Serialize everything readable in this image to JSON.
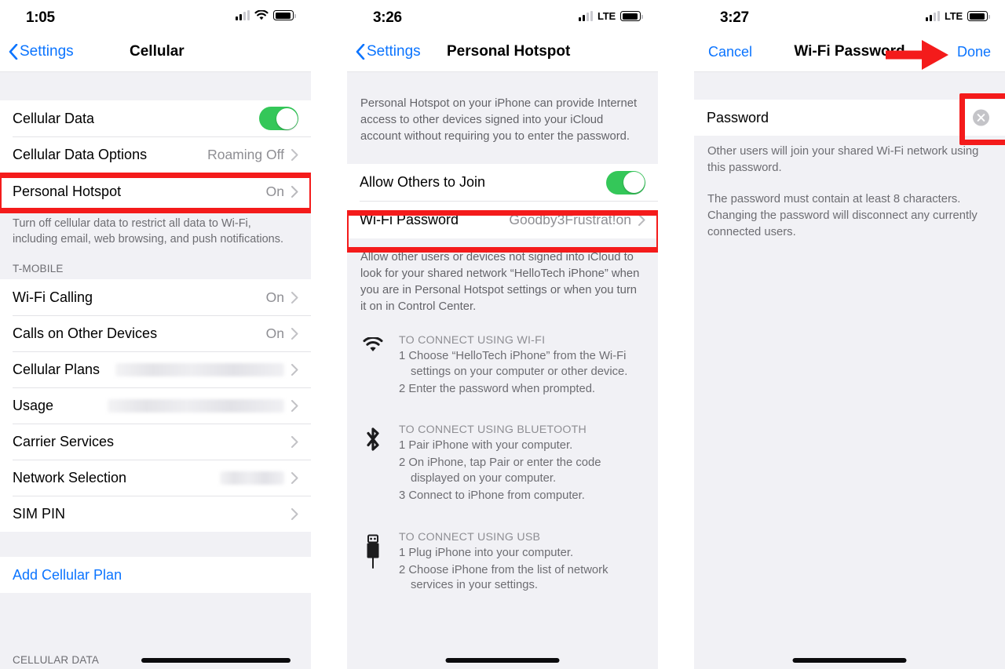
{
  "panels": [
    {
      "status": {
        "time": "1:05",
        "connectivity": "wifi",
        "signal_icon": "signal-bars-icon",
        "wifi_icon": "wifi-icon",
        "battery_icon": "battery-icon"
      },
      "nav": {
        "back_label": "Settings",
        "title": "Cellular",
        "back_icon": "chevron-left-icon"
      },
      "rows_group1": [
        {
          "label": "Cellular Data",
          "value": "",
          "control": "toggle",
          "toggle_on": true
        },
        {
          "label": "Cellular Data Options",
          "value": "Roaming Off",
          "control": "chevron"
        },
        {
          "label": "Personal Hotspot",
          "value": "On",
          "control": "chevron",
          "highlighted": true
        }
      ],
      "footnote": "Turn off cellular data to restrict all data to Wi-Fi, including email, web browsing, and push notifications.",
      "group_header": "T-MOBILE",
      "rows_group2": [
        {
          "label": "Wi-Fi Calling",
          "value": "On",
          "control": "chevron"
        },
        {
          "label": "Calls on Other Devices",
          "value": "On",
          "control": "chevron"
        },
        {
          "label": "Cellular Plans",
          "value": "",
          "control": "chevron",
          "redacted": true,
          "redact_width": 215
        },
        {
          "label": "Usage",
          "value": "",
          "control": "chevron",
          "redacted": true,
          "redact_width": 225
        },
        {
          "label": "Carrier Services",
          "value": "",
          "control": "chevron"
        },
        {
          "label": "Network Selection",
          "value": "",
          "control": "chevron",
          "redacted": true,
          "redact_width": 82
        },
        {
          "label": "SIM PIN",
          "value": "",
          "control": "chevron"
        }
      ],
      "rows_group3": [
        {
          "label": "Add Cellular Plan",
          "link": true
        }
      ],
      "bottom_label": "CELLULAR DATA"
    },
    {
      "status": {
        "time": "3:26",
        "connectivity": "LTE"
      },
      "nav": {
        "back_label": "Settings",
        "title": "Personal Hotspot"
      },
      "blurb": "Personal Hotspot on your iPhone can provide Internet access to other devices signed into your iCloud account without requiring you to enter the password.",
      "rows": [
        {
          "label": "Allow Others to Join",
          "control": "toggle",
          "toggle_on": true
        },
        {
          "label": "Wi-Fi Password",
          "value": "Goodby3Frustrat!on",
          "control": "chevron",
          "highlighted": true
        }
      ],
      "blurb2": "Allow other users or devices not signed into iCloud to look for your shared network “HelloTech iPhone” when you are in Personal Hotspot settings or when you turn it on in Control Center.",
      "instructions": [
        {
          "icon": "wifi-icon",
          "title": "TO CONNECT USING WI-FI",
          "steps": [
            "1 Choose “HelloTech iPhone” from the Wi-Fi settings on your computer or other device.",
            "2 Enter the password when prompted."
          ]
        },
        {
          "icon": "bluetooth-icon",
          "title": "TO CONNECT USING BLUETOOTH",
          "steps": [
            "1 Pair iPhone with your computer.",
            "2 On iPhone, tap Pair or enter the code displayed on your computer.",
            "3 Connect to iPhone from computer."
          ]
        },
        {
          "icon": "usb-icon",
          "title": "TO CONNECT USING USB",
          "steps": [
            "1 Plug iPhone into your computer.",
            "2 Choose iPhone from the list of network services in your settings."
          ]
        }
      ]
    },
    {
      "status": {
        "time": "3:27",
        "connectivity": "LTE"
      },
      "nav": {
        "cancel_label": "Cancel",
        "title": "Wi-Fi Password",
        "done_label": "Done"
      },
      "password_field": {
        "value": "Password",
        "clear_icon": "clear-circle-icon",
        "clear_highlighted": true
      },
      "note1": "Other users will join your shared Wi-Fi network using this password.",
      "note2": "The password must contain at least 8 characters. Changing the password will disconnect any currently connected users."
    }
  ],
  "annotations": {
    "highlight_color": "#f41b1b",
    "arrow_icon": "red-arrow-right-icon"
  },
  "colors": {
    "accent_blue": "#0b74ff",
    "toggle_green": "#34c759",
    "group_bg": "#f1f1f5",
    "secondary_text": "#8e8e93"
  }
}
